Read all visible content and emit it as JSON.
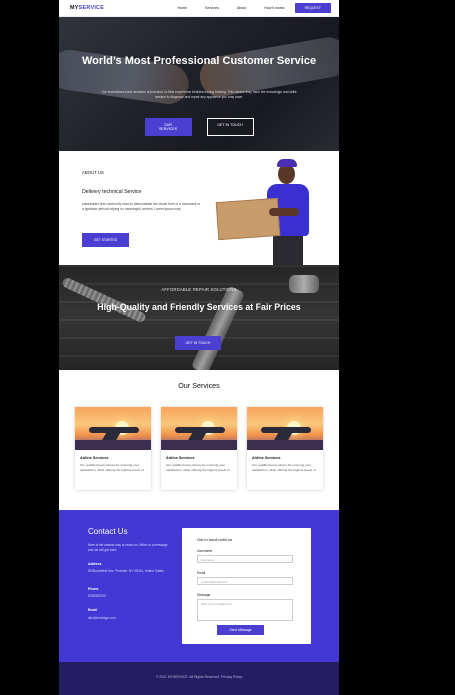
{
  "nav": {
    "logo_my": "MY",
    "logo_service": "SERVICE",
    "links": [
      "Home",
      "Services",
      "About",
      "How it works"
    ],
    "request_label": "REQUEST"
  },
  "hero": {
    "title": "World’s Most Professional Customer Service",
    "subtitle": "Our technicians have decades of practical, in-field experience besides having training. This means they have the knowledge and skills needed to diagnose and repair any appliance you may have.",
    "primary_button": "OUR SERVICES",
    "secondary_button": "GET IN TOUCH"
  },
  "about": {
    "label": "ABOUT US",
    "heading": "Delivery technical Service",
    "text": "placeholder text commonly used to demonstrate the visual form of a document or a typeface without relying on meaningful content. Lorem ipsum may",
    "button": "GET STARTED"
  },
  "afford": {
    "label": "AFFORDABLE REPAIR SOLUTIONS",
    "title": "High-Quality and Friendly Services at Fair Prices",
    "button": "GET IN TOUCH"
  },
  "services": {
    "title": "Our Services",
    "cards": [
      {
        "title": "Airline Services",
        "text": "Our qualified team strives for ensuring your satisfaction, while offering the highest levels of"
      },
      {
        "title": "Airline Services",
        "text": "Our qualified team strives for ensuring your satisfaction, while offering the highest levels of"
      },
      {
        "title": "Airline Services",
        "text": "Our qualified team strives for ensuring your satisfaction, while offering the highest levels of"
      }
    ]
  },
  "contact": {
    "title": "Contact Us",
    "subtitle": "Here is the easiest way to reach us. Write us a message and we will get back",
    "address_label": "Address",
    "address": "55 Bloomfield Ave. Pineville, NY 00044, United States",
    "phone_label": "Phone",
    "phone": "5750987000",
    "email_label": "Email",
    "email": "alim@mortage.com",
    "form": {
      "heading": "Get in touch with us",
      "username_label": "Username",
      "username_placeholder": "Username",
      "email_label": "Email",
      "email_placeholder": "youremail@mail.com",
      "message_label": "Message",
      "message_placeholder": "Write your message here",
      "send_label": "Send Message"
    }
  },
  "footer": {
    "text": "© 2021 MYSERVICE. All Rights Reserved. Privacy Policy"
  },
  "colors": {
    "accent": "#4a3fd1",
    "contact_bg": "#4338d4",
    "footer_bg": "#241d63"
  }
}
